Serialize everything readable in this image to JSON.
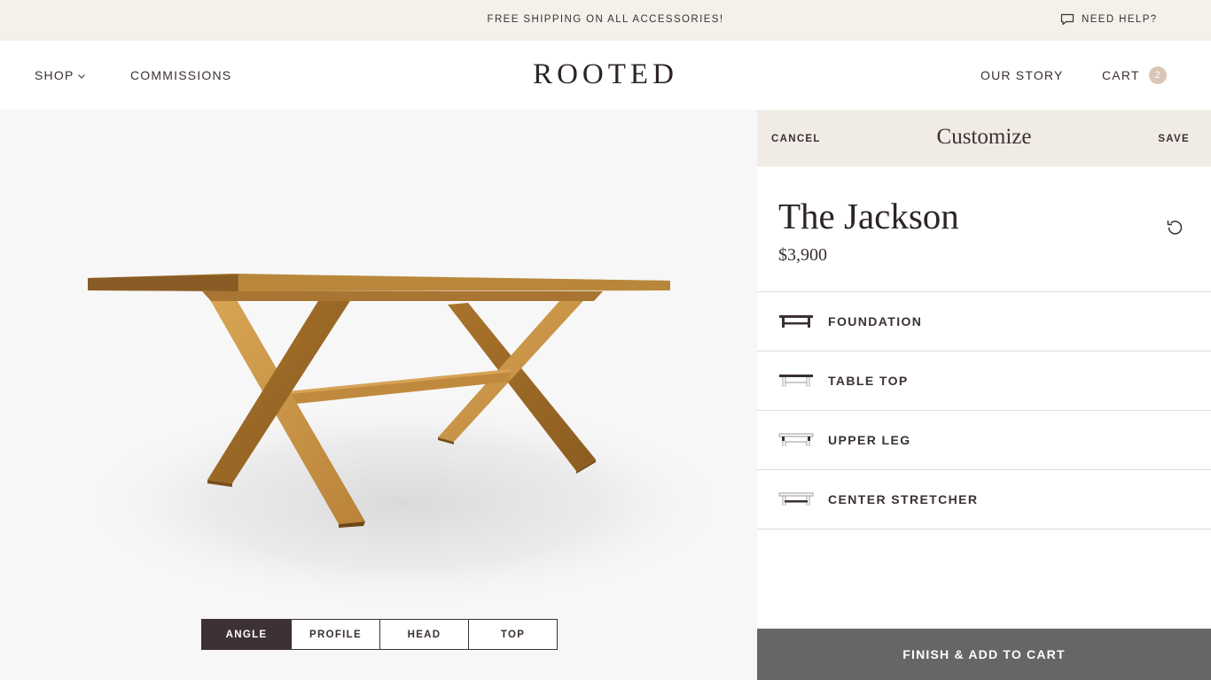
{
  "announcement": {
    "text": "FREE SHIPPING ON ALL ACCESSORIES!",
    "help_label": "NEED HELP?",
    "help_icon": "chat-bubble-icon"
  },
  "header": {
    "nav_left": [
      {
        "label": "SHOP",
        "has_dropdown": true
      },
      {
        "label": "COMMISSIONS"
      }
    ],
    "logo": "ROOTED",
    "nav_right": [
      {
        "label": "OUR STORY"
      },
      {
        "label": "CART",
        "count": "2"
      }
    ]
  },
  "viewer": {
    "image": "wood-x-leg-dining-table",
    "tabs": [
      {
        "label": "ANGLE",
        "active": true
      },
      {
        "label": "PROFILE"
      },
      {
        "label": "HEAD"
      },
      {
        "label": "TOP"
      }
    ]
  },
  "customizer": {
    "cancel_label": "CANCEL",
    "title": "Customize",
    "save_label": "SAVE",
    "product_name": "The Jackson",
    "price": "$3,900",
    "reset_icon": "reset-icon",
    "options": [
      {
        "label": "FOUNDATION",
        "icon": "foundation-icon"
      },
      {
        "label": "TABLE TOP",
        "icon": "table-top-icon"
      },
      {
        "label": "UPPER LEG",
        "icon": "upper-leg-icon"
      },
      {
        "label": "CENTER STRETCHER",
        "icon": "center-stretcher-icon"
      }
    ],
    "cta_label": "FINISH & ADD TO CART"
  },
  "colors": {
    "announcement_bg": "#f4f0ea",
    "panel_header_bg": "#f1ebe5",
    "active_tab_bg": "#3d3137",
    "cta_bg": "#676665",
    "cart_badge_bg": "#d9c6b6",
    "text": "#3a3035"
  }
}
